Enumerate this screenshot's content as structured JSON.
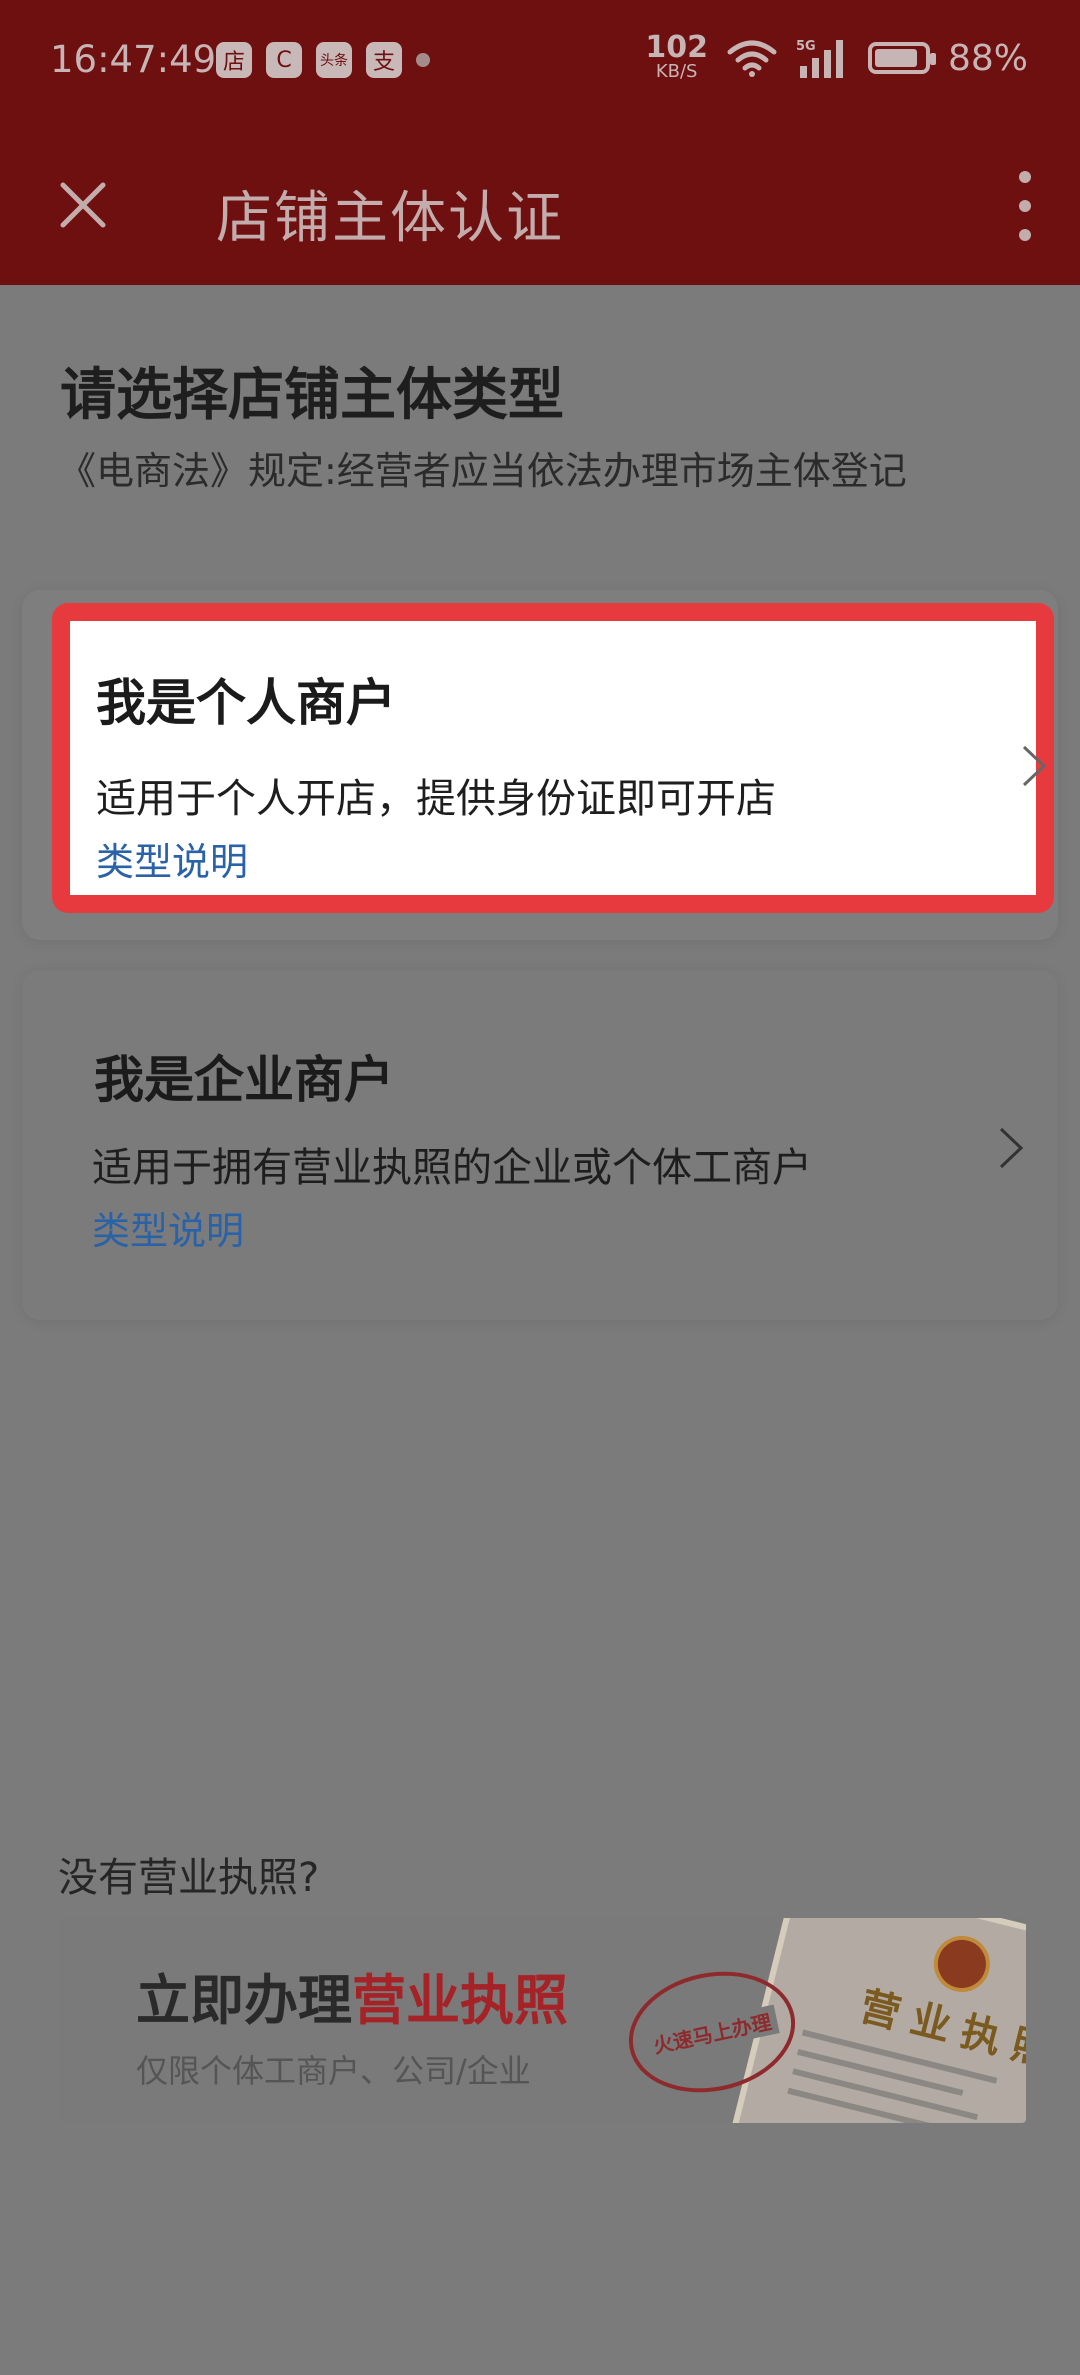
{
  "status_bar": {
    "time": "16:47:49",
    "app_icons": [
      "店",
      "C",
      "头条",
      "支"
    ],
    "net_speed_value": "102",
    "net_speed_unit": "KB/S",
    "network_type": "5G",
    "battery_percent": "88%"
  },
  "nav": {
    "title": "店铺主体认证"
  },
  "page": {
    "heading": "请选择店铺主体类型",
    "subheading": "《电商法》规定:经营者应当依法办理市场主体登记"
  },
  "options": [
    {
      "title": "我是个人商户",
      "description": "适用于个人开店，提供身份证即可开店",
      "link": "类型说明"
    },
    {
      "title": "我是企业商户",
      "description": "适用于拥有营业执照的企业或个体工商户",
      "link": "类型说明"
    }
  ],
  "license_prompt": "没有营业执照?",
  "banner": {
    "main_prefix": "立即办理",
    "main_highlight": "营业执照",
    "sub": "仅限个体工商户、公司/企业",
    "stamp_text": "火速马上办理",
    "license_title": "营业执照"
  },
  "colors": {
    "header_bg": "#6e0f10",
    "highlight_border": "#e63a3e",
    "link": "#2a62a8",
    "banner_highlight": "#a52226"
  }
}
